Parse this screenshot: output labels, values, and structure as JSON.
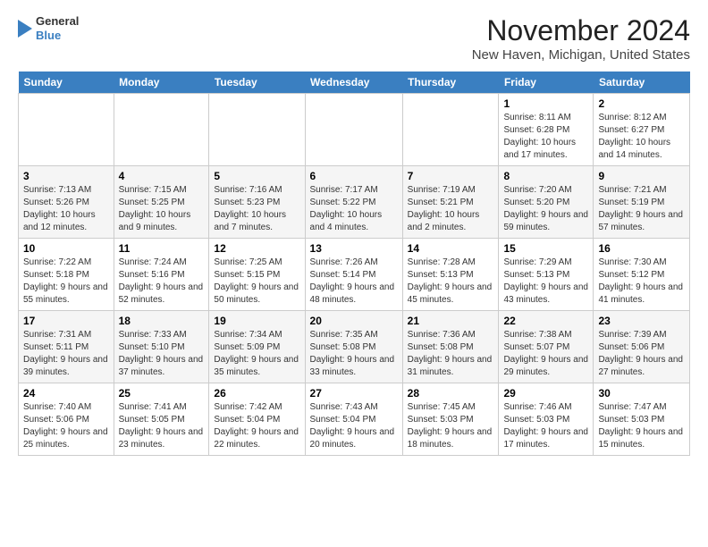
{
  "logo": {
    "line1": "General",
    "line2": "Blue"
  },
  "title": "November 2024",
  "location": "New Haven, Michigan, United States",
  "headers": [
    "Sunday",
    "Monday",
    "Tuesday",
    "Wednesday",
    "Thursday",
    "Friday",
    "Saturday"
  ],
  "weeks": [
    [
      {
        "day": "",
        "info": ""
      },
      {
        "day": "",
        "info": ""
      },
      {
        "day": "",
        "info": ""
      },
      {
        "day": "",
        "info": ""
      },
      {
        "day": "",
        "info": ""
      },
      {
        "day": "1",
        "info": "Sunrise: 8:11 AM\nSunset: 6:28 PM\nDaylight: 10 hours and 17 minutes."
      },
      {
        "day": "2",
        "info": "Sunrise: 8:12 AM\nSunset: 6:27 PM\nDaylight: 10 hours and 14 minutes."
      }
    ],
    [
      {
        "day": "3",
        "info": "Sunrise: 7:13 AM\nSunset: 5:26 PM\nDaylight: 10 hours and 12 minutes."
      },
      {
        "day": "4",
        "info": "Sunrise: 7:15 AM\nSunset: 5:25 PM\nDaylight: 10 hours and 9 minutes."
      },
      {
        "day": "5",
        "info": "Sunrise: 7:16 AM\nSunset: 5:23 PM\nDaylight: 10 hours and 7 minutes."
      },
      {
        "day": "6",
        "info": "Sunrise: 7:17 AM\nSunset: 5:22 PM\nDaylight: 10 hours and 4 minutes."
      },
      {
        "day": "7",
        "info": "Sunrise: 7:19 AM\nSunset: 5:21 PM\nDaylight: 10 hours and 2 minutes."
      },
      {
        "day": "8",
        "info": "Sunrise: 7:20 AM\nSunset: 5:20 PM\nDaylight: 9 hours and 59 minutes."
      },
      {
        "day": "9",
        "info": "Sunrise: 7:21 AM\nSunset: 5:19 PM\nDaylight: 9 hours and 57 minutes."
      }
    ],
    [
      {
        "day": "10",
        "info": "Sunrise: 7:22 AM\nSunset: 5:18 PM\nDaylight: 9 hours and 55 minutes."
      },
      {
        "day": "11",
        "info": "Sunrise: 7:24 AM\nSunset: 5:16 PM\nDaylight: 9 hours and 52 minutes."
      },
      {
        "day": "12",
        "info": "Sunrise: 7:25 AM\nSunset: 5:15 PM\nDaylight: 9 hours and 50 minutes."
      },
      {
        "day": "13",
        "info": "Sunrise: 7:26 AM\nSunset: 5:14 PM\nDaylight: 9 hours and 48 minutes."
      },
      {
        "day": "14",
        "info": "Sunrise: 7:28 AM\nSunset: 5:13 PM\nDaylight: 9 hours and 45 minutes."
      },
      {
        "day": "15",
        "info": "Sunrise: 7:29 AM\nSunset: 5:13 PM\nDaylight: 9 hours and 43 minutes."
      },
      {
        "day": "16",
        "info": "Sunrise: 7:30 AM\nSunset: 5:12 PM\nDaylight: 9 hours and 41 minutes."
      }
    ],
    [
      {
        "day": "17",
        "info": "Sunrise: 7:31 AM\nSunset: 5:11 PM\nDaylight: 9 hours and 39 minutes."
      },
      {
        "day": "18",
        "info": "Sunrise: 7:33 AM\nSunset: 5:10 PM\nDaylight: 9 hours and 37 minutes."
      },
      {
        "day": "19",
        "info": "Sunrise: 7:34 AM\nSunset: 5:09 PM\nDaylight: 9 hours and 35 minutes."
      },
      {
        "day": "20",
        "info": "Sunrise: 7:35 AM\nSunset: 5:08 PM\nDaylight: 9 hours and 33 minutes."
      },
      {
        "day": "21",
        "info": "Sunrise: 7:36 AM\nSunset: 5:08 PM\nDaylight: 9 hours and 31 minutes."
      },
      {
        "day": "22",
        "info": "Sunrise: 7:38 AM\nSunset: 5:07 PM\nDaylight: 9 hours and 29 minutes."
      },
      {
        "day": "23",
        "info": "Sunrise: 7:39 AM\nSunset: 5:06 PM\nDaylight: 9 hours and 27 minutes."
      }
    ],
    [
      {
        "day": "24",
        "info": "Sunrise: 7:40 AM\nSunset: 5:06 PM\nDaylight: 9 hours and 25 minutes."
      },
      {
        "day": "25",
        "info": "Sunrise: 7:41 AM\nSunset: 5:05 PM\nDaylight: 9 hours and 23 minutes."
      },
      {
        "day": "26",
        "info": "Sunrise: 7:42 AM\nSunset: 5:04 PM\nDaylight: 9 hours and 22 minutes."
      },
      {
        "day": "27",
        "info": "Sunrise: 7:43 AM\nSunset: 5:04 PM\nDaylight: 9 hours and 20 minutes."
      },
      {
        "day": "28",
        "info": "Sunrise: 7:45 AM\nSunset: 5:03 PM\nDaylight: 9 hours and 18 minutes."
      },
      {
        "day": "29",
        "info": "Sunrise: 7:46 AM\nSunset: 5:03 PM\nDaylight: 9 hours and 17 minutes."
      },
      {
        "day": "30",
        "info": "Sunrise: 7:47 AM\nSunset: 5:03 PM\nDaylight: 9 hours and 15 minutes."
      }
    ]
  ]
}
